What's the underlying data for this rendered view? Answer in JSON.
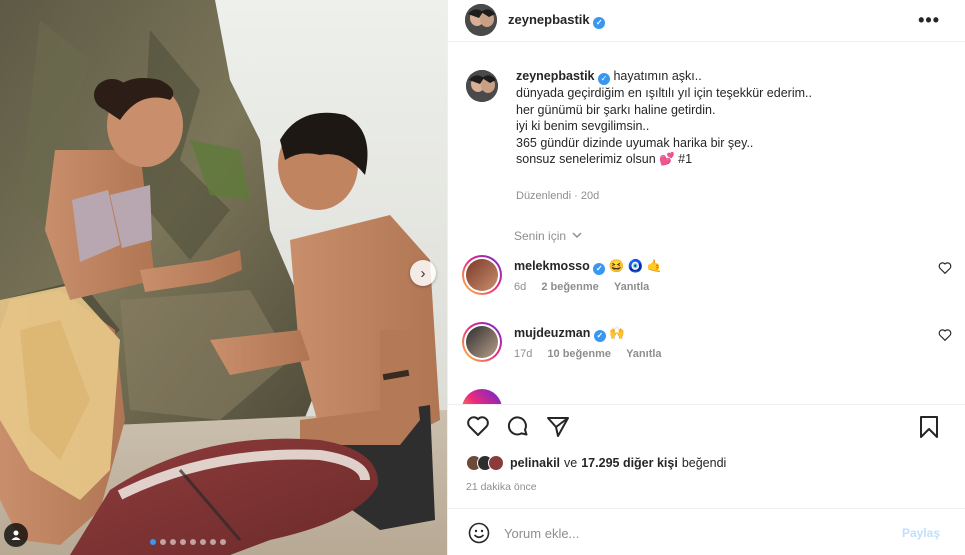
{
  "post": {
    "username": "zeynepbastik",
    "verified": true,
    "more_icon": "more-horizontal-icon"
  },
  "caption": {
    "username": "zeynepbastik",
    "lines": [
      "hayatımın aşkı..",
      "dünyada geçirdiğim en ışıltılı yıl için teşekkür ederim..",
      "her günümü bir şarkı haline getirdin.",
      "iyi ki benim sevgilimsin..",
      "365 gündür dizinde uyumak harika bir şey..",
      "sonsuz senelerimiz olsun 💕 #1"
    ],
    "edited_label": "Düzenlendi",
    "edited_time": "20d"
  },
  "filter": {
    "label": "Senin için",
    "icon": "chevron-down-icon"
  },
  "comments": [
    {
      "username": "melekmosso",
      "verified": true,
      "emojis": "😆 🧿 🤙",
      "age": "6d",
      "likes": "2 beğenme",
      "reply": "Yanıtla"
    },
    {
      "username": "mujdeuzman",
      "verified": true,
      "emojis": "🙌",
      "age": "17d",
      "likes": "10 beğenme",
      "reply": "Yanıtla"
    }
  ],
  "actions": {
    "like_icon": "heart-icon",
    "comment_icon": "comment-icon",
    "share_icon": "send-icon",
    "save_icon": "bookmark-icon"
  },
  "likes": {
    "first_user": "pelinakil",
    "connector": "ve",
    "others": "17.295 diğer kişi",
    "suffix": "beğendi"
  },
  "time_ago": "21 dakika önce",
  "comment_box": {
    "placeholder": "Yorum ekle...",
    "post_label": "Paylaş",
    "emoji_icon": "smiley-icon"
  },
  "colors": {
    "verified": "#3897f0",
    "muted": "#8e8e8e",
    "text": "#262626",
    "post_disabled": "#c0dffd"
  }
}
